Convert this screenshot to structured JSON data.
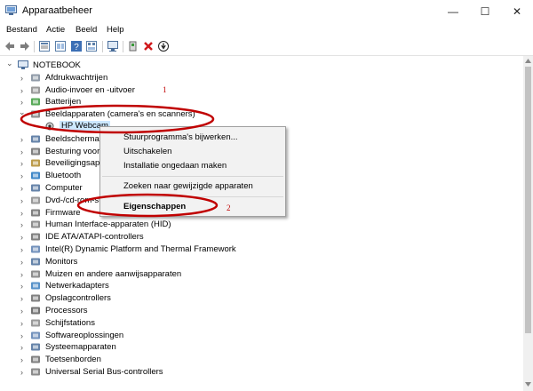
{
  "window": {
    "title": "Apparaatbeheer"
  },
  "window_controls": {
    "minimize": "—",
    "maximize": "☐",
    "close": "✕"
  },
  "menu": [
    "Bestand",
    "Actie",
    "Beeld",
    "Help"
  ],
  "toolbar_icons": [
    "back-arrow-icon",
    "forward-arrow-icon",
    "properties-icon",
    "show-hidden-icon",
    "help-icon",
    "details-icon",
    "scan-hardware-icon",
    "add-driver-icon",
    "uninstall-icon",
    "update-icon"
  ],
  "tree": {
    "root": "NOTEBOOK",
    "items": [
      "Afdrukwachtrijen",
      "Audio-invoer en -uitvoer",
      "Batterijen",
      "Beeldapparaten (camera's en scanners)",
      "HP Webcam",
      "Beeldschermadapters",
      "Besturing voor",
      "Beveiligingsapparaten",
      "Bluetooth",
      "Computer",
      "Dvd-/cd-rom-stations",
      "Firmware",
      "Human Interface-apparaten (HID)",
      "IDE ATA/ATAPI-controllers",
      "Intel(R) Dynamic Platform and Thermal Framework",
      "Monitors",
      "Muizen en andere aanwijsapparaten",
      "Netwerkadapters",
      "Opslagcontrollers",
      "Processors",
      "Schijfstations",
      "Softwareoplossingen",
      "Systeemapparaten",
      "Toetsenborden",
      "Universal Serial Bus-controllers"
    ]
  },
  "context_menu": {
    "items": [
      "Stuurprogramma's bijwerken...",
      "Uitschakelen",
      "Installatie ongedaan maken",
      "Zoeken naar gewijzigde apparaten",
      "Eigenschappen"
    ]
  },
  "annotations": {
    "marker1": "1",
    "marker2": "2",
    "color": "#c00000"
  }
}
